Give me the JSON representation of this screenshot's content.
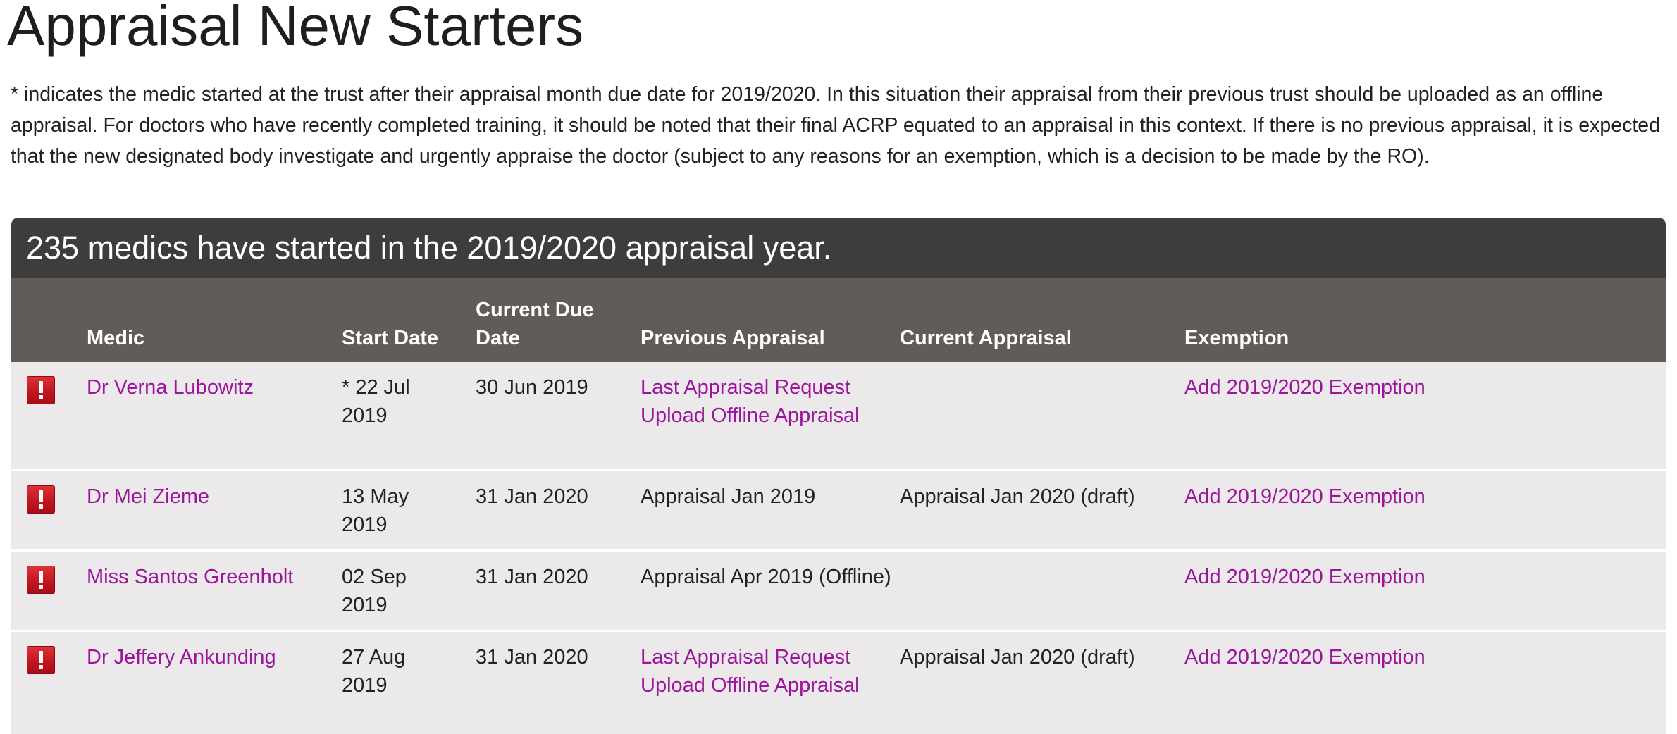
{
  "page": {
    "title": "Appraisal New Starters",
    "intro": "* indicates the medic started at the trust after their appraisal month due date for 2019/2020. In this situation their appraisal from their previous trust should be uploaded as an offline appraisal. For doctors who have recently completed training, it should be noted that their final ACRP equated to an appraisal in this context. If there is no previous appraisal, it is expected that the new designated body investigate and urgently appraise the doctor (subject to any reasons for an exemption, which is a decision to be made by the RO)."
  },
  "panel": {
    "heading": "235 medics have started in the 2019/2020 appraisal year.",
    "columns": {
      "medic": "Medic",
      "start_date": "Start Date",
      "current_due_line1": "Current Due",
      "current_due_line2": "Date",
      "previous_appraisal": "Previous Appraisal",
      "current_appraisal": "Current Appraisal",
      "exemption": "Exemption"
    },
    "rows": [
      {
        "icon": "alert-icon",
        "medic": "Dr Verna Lubowitz",
        "start_line1": "* 22 Jul",
        "start_line2": "2019",
        "due": "30 Jun 2019",
        "previous_link1": "Last Appraisal Request",
        "previous_link2": "Upload Offline Appraisal",
        "current": "",
        "exemption": "Add 2019/2020 Exemption"
      },
      {
        "icon": "alert-icon",
        "medic": "Dr Mei Zieme",
        "start_line1": "13 May",
        "start_line2": "2019",
        "due": "31 Jan 2020",
        "previous_text": "Appraisal Jan 2019",
        "current": "Appraisal Jan 2020 (draft)",
        "exemption": "Add 2019/2020 Exemption"
      },
      {
        "icon": "alert-icon",
        "medic": "Miss Santos Greenholt",
        "start_line1": "02 Sep",
        "start_line2": "2019",
        "due": "31 Jan 2020",
        "previous_text": "Appraisal Apr 2019 (Offline)",
        "current": "",
        "exemption": "Add 2019/2020 Exemption"
      },
      {
        "icon": "alert-icon",
        "medic": "Dr Jeffery Ankunding",
        "start_line1": "27 Aug",
        "start_line2": "2019",
        "due": "31 Jan 2020",
        "previous_link1": "Last Appraisal Request",
        "previous_link2": "Upload Offline Appraisal",
        "current": "Appraisal Jan 2020 (draft)",
        "exemption": "Add 2019/2020 Exemption"
      }
    ]
  },
  "colors": {
    "link": "#9c159c",
    "panel_header_bg": "#3e3d3b",
    "table_header_bg": "#5f5c59",
    "row_bg": "#ebe9ea",
    "alert_red": "#c3161f"
  }
}
